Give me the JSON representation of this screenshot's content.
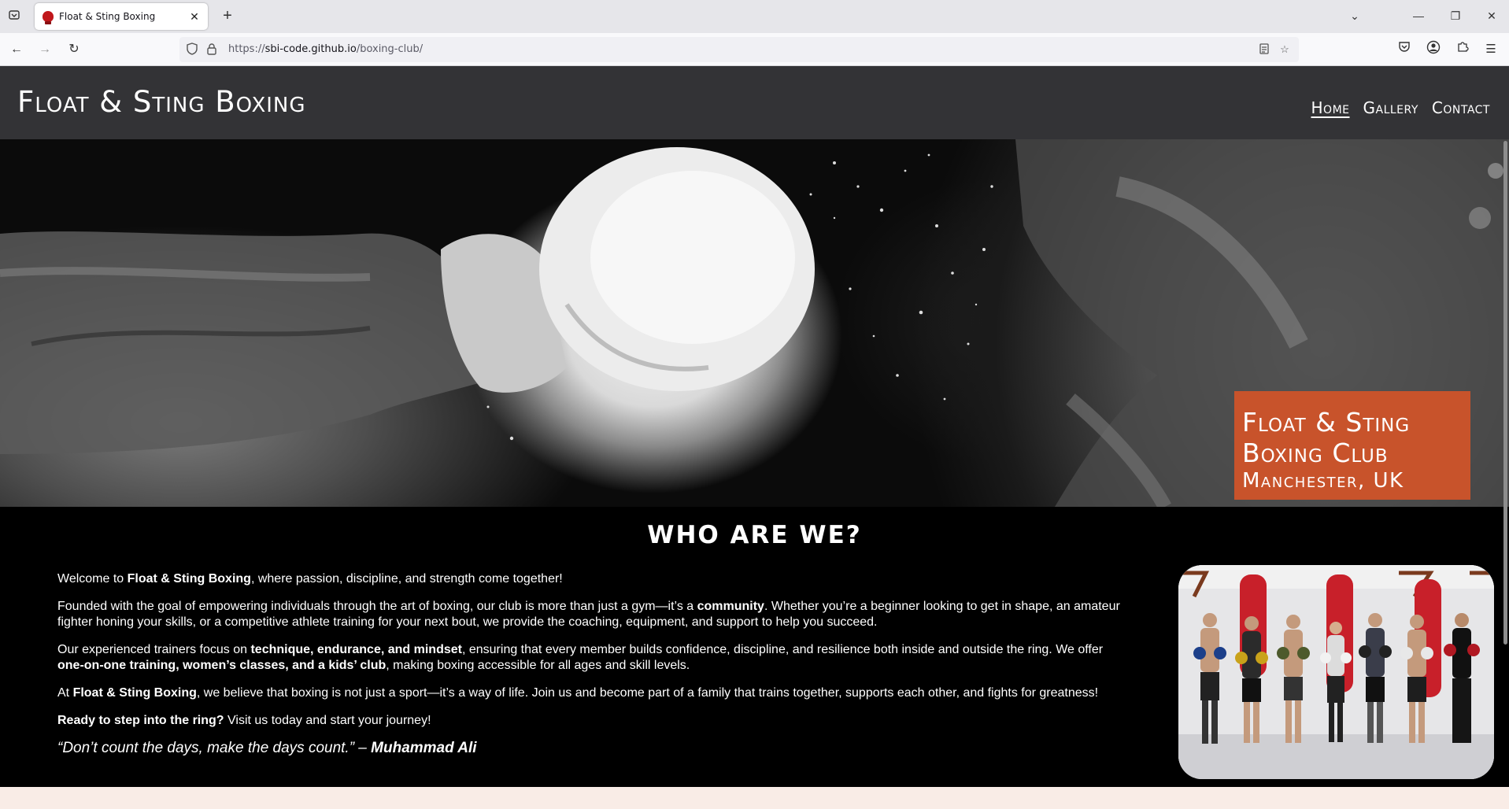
{
  "browser": {
    "tab_title": "Float & Sting Boxing",
    "url_prefix": "https://",
    "url_host": "sbi-code.github.io",
    "url_path": "/boxing-club/"
  },
  "site": {
    "logo": "Float & Sting Boxing",
    "nav": [
      {
        "label": "Home",
        "active": true
      },
      {
        "label": "Gallery",
        "active": false
      },
      {
        "label": "Contact",
        "active": false
      }
    ]
  },
  "hero": {
    "badge_line1": "Float & Sting",
    "badge_line2": "Boxing Club",
    "badge_line3": "Manchester, UK"
  },
  "about": {
    "title": "WHO ARE WE?",
    "p1_pre": "Welcome to ",
    "p1_bold": "Float & Sting Boxing",
    "p1_post": ", where passion, discipline, and strength come together!",
    "p2_pre": "Founded with the goal of empowering individuals through the art of boxing, our club is more than just a gym—it’s a ",
    "p2_bold": "community",
    "p2_post": ". Whether you’re a beginner looking to get in shape, an amateur fighter honing your skills, or a competitive athlete training for your next bout, we provide the coaching, equipment, and support to help you succeed.",
    "p3_pre": "Our experienced trainers focus on ",
    "p3_bold1": "technique, endurance, and mindset",
    "p3_mid": ", ensuring that every member builds confidence, discipline, and resilience both inside and outside the ring. We offer ",
    "p3_bold2": "one-on-one training, women’s classes, and a kids’ club",
    "p3_post": ", making boxing accessible for all ages and skill levels.",
    "p4_pre": "At ",
    "p4_bold": "Float & Sting Boxing",
    "p4_post": ", we believe that boxing is not just a sport—it’s a way of life. Join us and become part of a family that trains together, supports each other, and fights for greatness!",
    "p5_bold": "Ready to step into the ring?",
    "p5_post": " Visit us today and start your journey!",
    "quote_text": "“Don’t count the days, make the days count.” – ",
    "quote_author": "Muhammad Ali"
  },
  "colors": {
    "header_bg": "#333336",
    "badge_bg": "#c8532b",
    "about_bg": "#000000",
    "page_bg": "#f9ece6"
  },
  "icons": {
    "tab_list": "tab-list-icon",
    "back": "back-arrow-icon",
    "forward": "forward-arrow-icon",
    "reload": "reload-icon",
    "shield": "shield-icon",
    "lock": "lock-icon",
    "reader": "reader-view-icon",
    "bookmark": "star-icon",
    "pocket": "pocket-icon",
    "account": "account-icon",
    "extensions": "puzzle-icon",
    "menu": "hamburger-menu-icon"
  }
}
